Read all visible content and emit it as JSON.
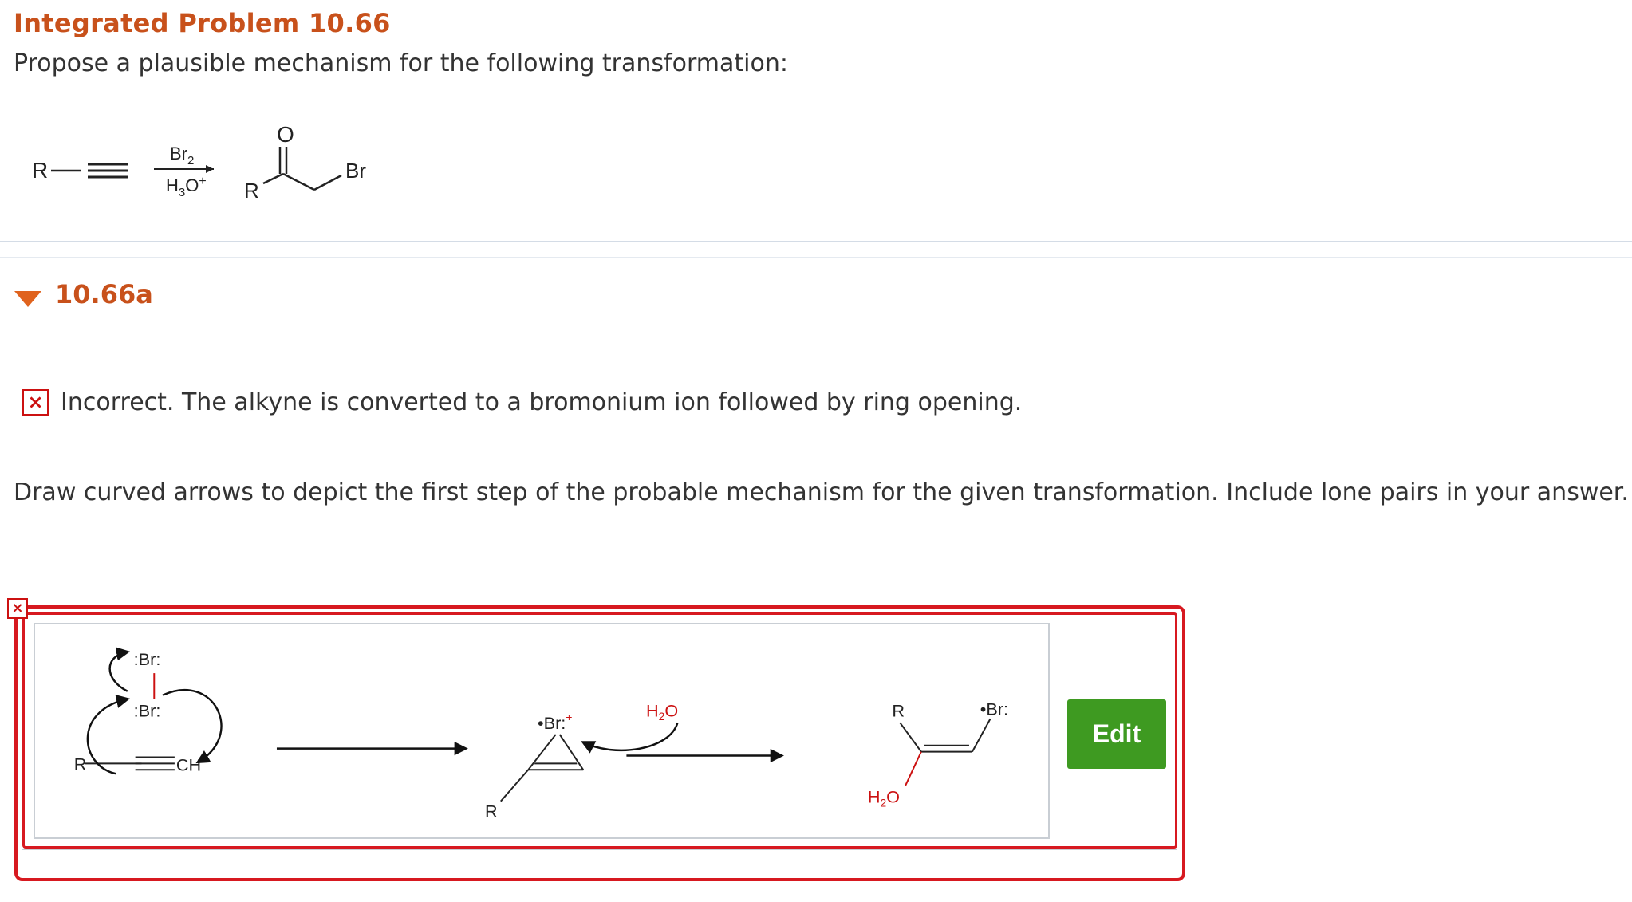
{
  "problem": {
    "title": "Integrated Problem 10.66",
    "prompt": "Propose a plausible mechanism for the following transformation:"
  },
  "scheme": {
    "reactant_r": "R",
    "reagent_top": "Br",
    "reagent_top_sub": "2",
    "reagent_bottom": "H",
    "reagent_bottom_sub": "3",
    "reagent_bottom_tail": "O",
    "reagent_bottom_sup": "+",
    "product_o": "O",
    "product_r": "R",
    "product_br": "Br"
  },
  "part": {
    "label": "10.66a"
  },
  "feedback": {
    "icon": "×",
    "text": "Incorrect. The alkyne is converted to a bromonium ion followed by ring opening."
  },
  "instruction": "Draw curved arrows to depict the first step of the probable mechanism for the given transformation. Include lone pairs in your answer.",
  "answer": {
    "status_icon": "×",
    "edit_label": "Edit",
    "drawing": {
      "s1_br_top": ":Br:",
      "s1_br_bottom": ":Br:",
      "s1_r": "R",
      "s1_ch": "CH",
      "s2_br": "•Br:",
      "s2_plus": "+",
      "s2_r": "R",
      "s2_h2o_h": "H",
      "s2_h2o_sub": "2",
      "s2_h2o_o": "O",
      "s3_r": "R",
      "s3_br": "•Br:",
      "s3_h2o_h": "H",
      "s3_h2o_sub": "2",
      "s3_h2o_o": "O"
    }
  },
  "colors": {
    "title_orange": "#c8511b",
    "error_red": "#d71920",
    "edit_green": "#3e9a21",
    "lone_pair_red": "#cc1111"
  }
}
